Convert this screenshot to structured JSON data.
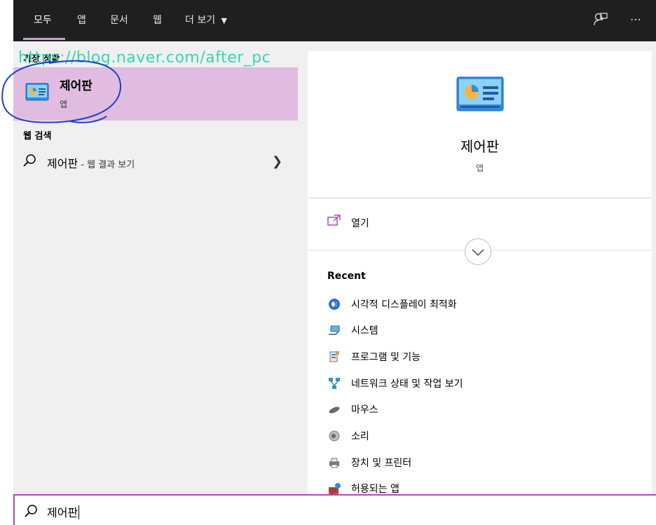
{
  "tabs": [
    {
      "label": "모두",
      "active": true
    },
    {
      "label": "앱",
      "active": false
    },
    {
      "label": "문서",
      "active": false
    },
    {
      "label": "웹",
      "active": false
    },
    {
      "label": "더 보기",
      "active": false,
      "has_dropdown": true
    }
  ],
  "topbar_icons": [
    "feedback-icon",
    "more-options-icon"
  ],
  "best_match": {
    "section_title": "가장 정확",
    "title": "제어판",
    "subtitle": "앱",
    "icon": "control-panel-icon"
  },
  "watermark": "https://blog.naver.com/after_pc",
  "web_search": {
    "section_title": "웹 검색",
    "query": "제어판",
    "suffix": " - 웹 결과 보기"
  },
  "detail": {
    "title": "제어판",
    "subtitle": "앱",
    "open_label": "열기"
  },
  "recent": {
    "title": "Recent",
    "items": [
      {
        "label": "시각적 디스플레이 최적화",
        "icon": "accessibility-icon"
      },
      {
        "label": "시스템",
        "icon": "system-icon"
      },
      {
        "label": "프로그램 및 기능",
        "icon": "programs-icon"
      },
      {
        "label": "네트워크 상태 및 작업 보기",
        "icon": "network-icon"
      },
      {
        "label": "마우스",
        "icon": "mouse-icon"
      },
      {
        "label": "소리",
        "icon": "sound-icon"
      },
      {
        "label": "장치 및 프린터",
        "icon": "devices-printers-icon"
      },
      {
        "label": "허용되는 앱",
        "icon": "firewall-apps-icon"
      }
    ]
  },
  "search": {
    "value": "제어판"
  },
  "colors": {
    "accent": "#b14ab8",
    "selected": "#e0bde0",
    "watermark": "#39d4b6",
    "annotation": "#1a3fc4"
  }
}
